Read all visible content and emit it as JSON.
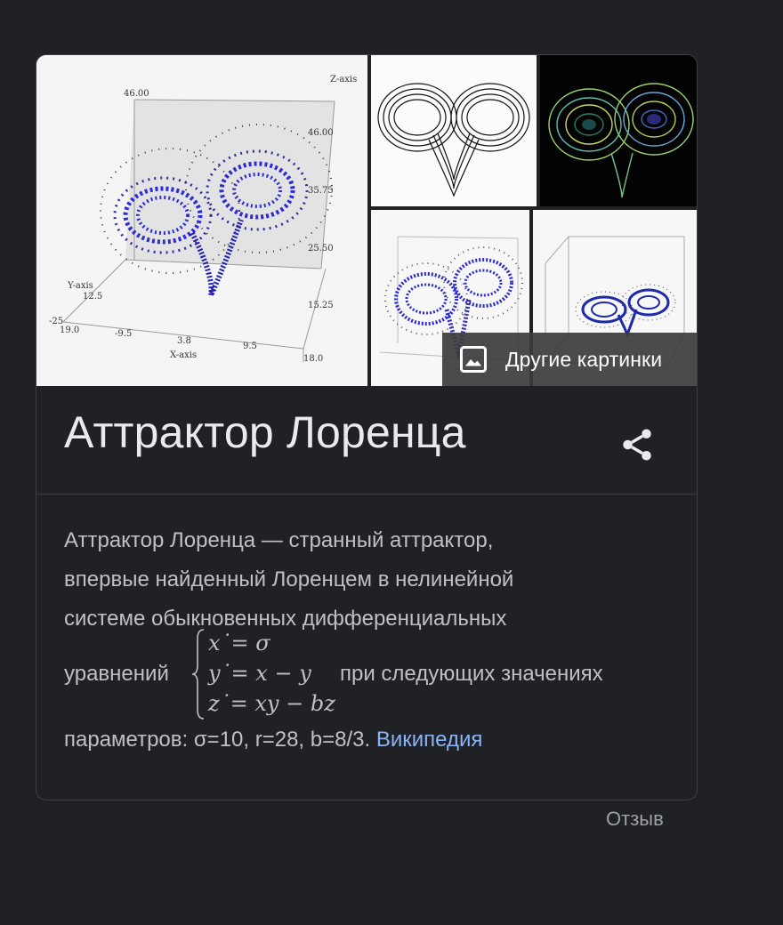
{
  "gallery": {
    "images": [
      {
        "name": "lorenz-3d-plot",
        "labels": {
          "z_axis": "Z-axis",
          "y_axis": "Y-axis",
          "x_axis": "X-axis",
          "ticks": [
            "46.00",
            "46.00",
            "35.75",
            "25.50",
            "15.25",
            "-25",
            "-9.5",
            "3.8",
            "9.5",
            "18.0",
            "12.5",
            "19.0"
          ]
        }
      },
      {
        "name": "lorenz-black-lines"
      },
      {
        "name": "lorenz-colored-dark"
      },
      {
        "name": "lorenz-blue-dots"
      },
      {
        "name": "lorenz-3d-small"
      }
    ],
    "more_images_label": "Другие картинки"
  },
  "panel": {
    "title": "Аттрактор Лоренца",
    "description": {
      "line1": "Аттрактор Лоренца — странный аттрактор,",
      "line2": "впервые найденный Лоренцем в нелинейной",
      "line3": "системе обыкновенных дифференциальных",
      "eq_prefix": "уравнений",
      "equations": [
        "x˙= σ",
        "y˙= x − y",
        "z˙= xy − bz"
      ],
      "eq_suffix": "при следующих значениях",
      "last_line": "параметров: σ=10, r=28, b=8/3.",
      "source_link": "Википедия"
    }
  },
  "feedback_label": "Отзыв",
  "colors": {
    "background": "#202124",
    "title": "#e8eaed",
    "body_text": "#bdc1c6",
    "link": "#8ab4f8",
    "muted": "#9aa0a6"
  }
}
